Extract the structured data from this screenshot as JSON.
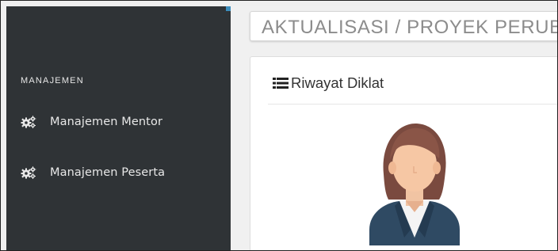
{
  "sidebar": {
    "section_header": "MANAJEMEN",
    "items": [
      {
        "label": "Manajemen Mentor",
        "icon": "gears-icon"
      },
      {
        "label": "Manajemen Peserta",
        "icon": "gears-icon"
      }
    ]
  },
  "header": {
    "title": "AKTUALISASI / PROYEK PERUBAHAN"
  },
  "panel": {
    "title": "Riwayat Diklat",
    "title_icon": "list-icon",
    "avatar_icon": "female-avatar-icon"
  },
  "colors": {
    "sidebar_bg": "#2f3336",
    "accent": "#3c8dbc",
    "title_text": "#8c8c8c"
  }
}
